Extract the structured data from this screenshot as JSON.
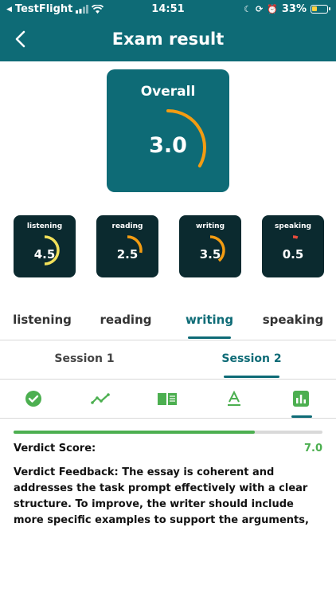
{
  "status_bar": {
    "carrier": "TestFlight",
    "time": "14:51",
    "battery": "33%",
    "battery_level": 0.33
  },
  "header": {
    "title": "Exam result"
  },
  "overall": {
    "label": "Overall",
    "value": "3.0",
    "score": 3.0,
    "max": 9,
    "arc_color": "#f39c12"
  },
  "skills": [
    {
      "name": "listening",
      "value": "4.5",
      "score": 4.5,
      "color": "#f1e05a"
    },
    {
      "name": "reading",
      "value": "2.5",
      "score": 2.5,
      "color": "#f39c12"
    },
    {
      "name": "writing",
      "value": "3.5",
      "score": 3.5,
      "color": "#f39c12"
    },
    {
      "name": "speaking",
      "value": "0.5",
      "score": 0.5,
      "color": "#e74c3c"
    }
  ],
  "tabs": [
    {
      "label": "listening",
      "active": false
    },
    {
      "label": "reading",
      "active": false
    },
    {
      "label": "writing",
      "active": true
    },
    {
      "label": "speaking",
      "active": false
    }
  ],
  "sessions": [
    {
      "label": "Session 1",
      "active": false
    },
    {
      "label": "Session 2",
      "active": true
    }
  ],
  "toolbar_icons": [
    "check-circle-icon",
    "trend-line-icon",
    "book-icon",
    "text-format-icon",
    "bar-chart-icon"
  ],
  "active_toolbar_icon": "bar-chart-icon",
  "verdict": {
    "score_label": "Verdict Score:",
    "score_value": "7.0",
    "progress": 0.78,
    "feedback": "Verdict Feedback: The essay is coherent and addresses the task prompt effectively with a clear structure. To improve, the writer should include more specific examples to support the arguments,"
  },
  "colors": {
    "teal": "#0e6b76",
    "dark_card": "#0b2a2f",
    "green": "#4caf50"
  }
}
